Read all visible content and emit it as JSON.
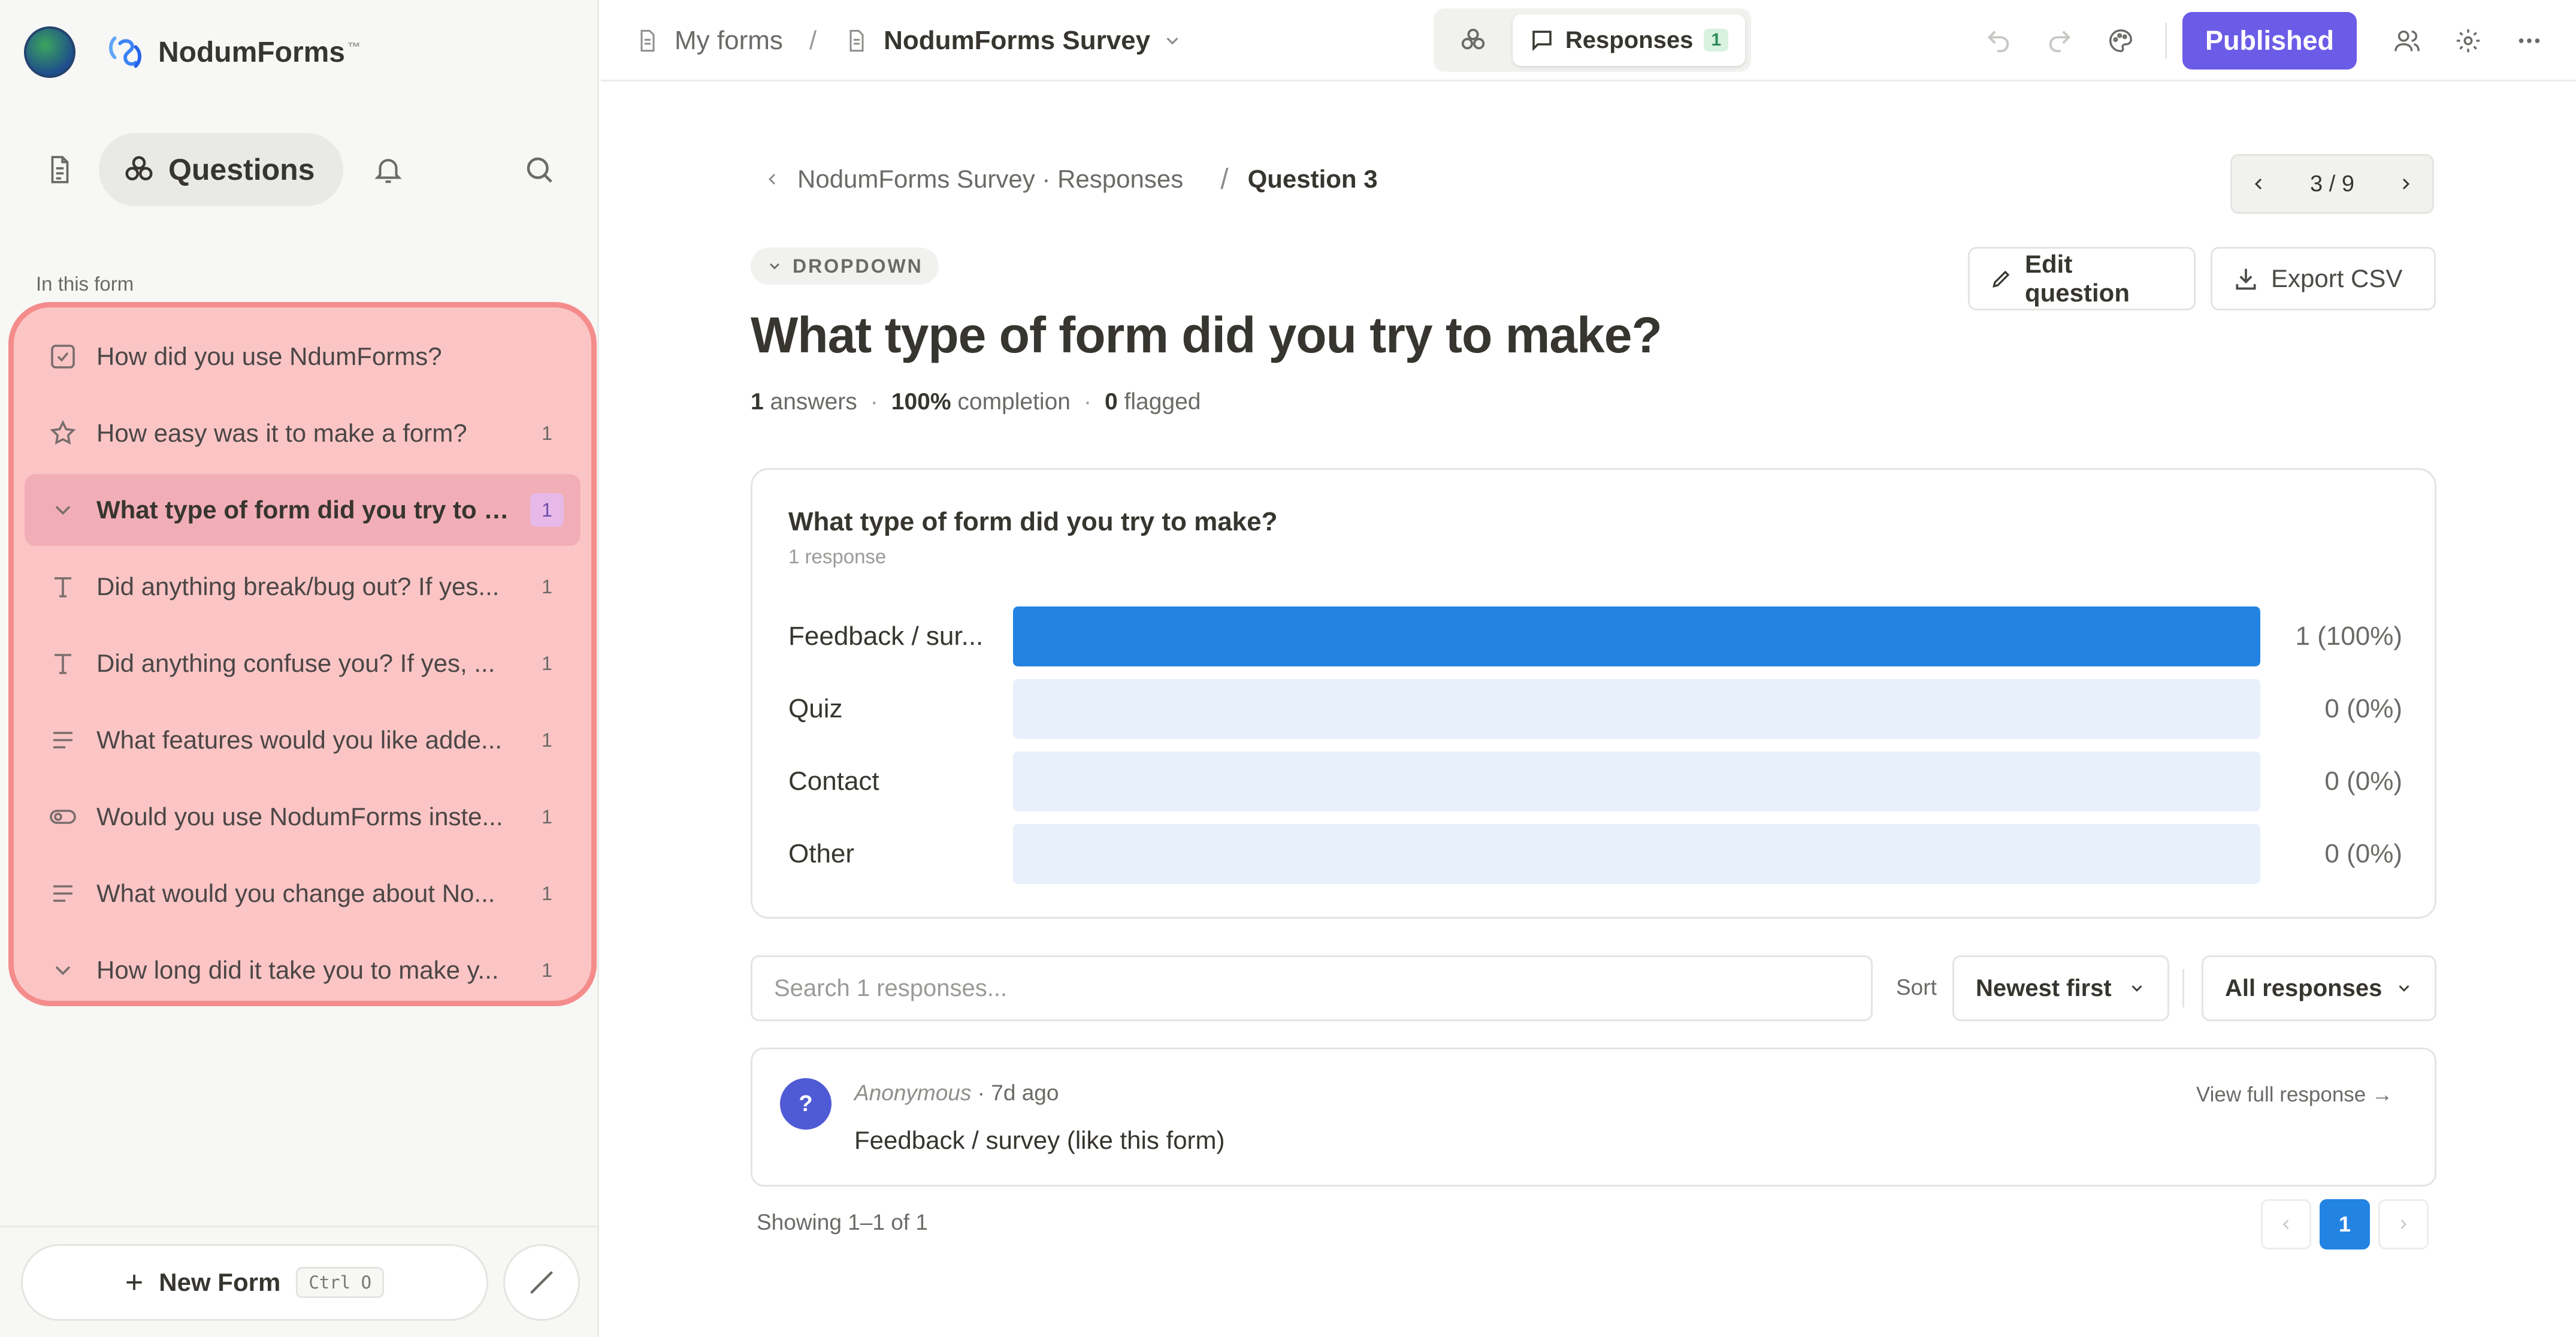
{
  "brand": {
    "name": "NodumForms",
    "tm": "™"
  },
  "colors": {
    "accent": "#2383e2",
    "publish": "#6b5ce7",
    "highlight_fill": "#fbc5c5",
    "highlight_border": "#f58c8c"
  },
  "sidebar": {
    "tabs": [
      {
        "icon": "document-icon"
      },
      {
        "icon": "questions-icon",
        "label": "Questions"
      },
      {
        "icon": "bell-icon"
      },
      {
        "icon": "search-icon"
      }
    ],
    "section_label": "In this form",
    "questions": [
      {
        "icon": "checkbox-icon",
        "label": "How did you use NdumForms?",
        "count": ""
      },
      {
        "icon": "star-icon",
        "label": "How easy was it to make a form?",
        "count": "1"
      },
      {
        "icon": "chevron-down-icon",
        "label": "What type of form did you try to m...",
        "count": "1",
        "active": true
      },
      {
        "icon": "text-icon",
        "label": "Did anything break/bug out? If yes...",
        "count": "1"
      },
      {
        "icon": "text-icon",
        "label": "Did anything confuse you? If yes, ...",
        "count": "1"
      },
      {
        "icon": "paragraph-icon",
        "label": "What features would you like adde...",
        "count": "1"
      },
      {
        "icon": "toggle-icon",
        "label": "Would you use NodumForms inste...",
        "count": "1"
      },
      {
        "icon": "paragraph-icon",
        "label": "What would you change about No...",
        "count": "1"
      },
      {
        "icon": "chevron-down-icon",
        "label": "How long did it take you to make y...",
        "count": "1"
      }
    ],
    "new_form": {
      "label": "New Form",
      "shortcut": "Ctrl O"
    }
  },
  "topbar": {
    "breadcrumb": {
      "root": "My forms",
      "sep": "/",
      "current": "NodumForms Survey"
    },
    "view_toggle": {
      "responses_label": "Responses",
      "responses_count": "1"
    },
    "published_label": "Published"
  },
  "main": {
    "breadcrumb": {
      "parent": "NodumForms Survey · Responses",
      "sep": "/",
      "current": "Question 3"
    },
    "pager": {
      "position": "3 / 9"
    },
    "type_label": "DROPDOWN",
    "edit_label": "Edit question",
    "export_label": "Export CSV",
    "question_title": "What type of form did you try to make?",
    "stats": {
      "answers_value": "1",
      "answers_label": "answers",
      "completion_value": "100%",
      "completion_label": "completion",
      "flagged_value": "0",
      "flagged_label": "flagged"
    },
    "chart": {
      "title": "What type of form did you try to make?",
      "subtitle": "1 response",
      "rows": [
        {
          "label": "Feedback / sur...",
          "fraction": 1,
          "value_text": "1 (100%)"
        },
        {
          "label": "Quiz",
          "fraction": 0,
          "value_text": "0 (0%)"
        },
        {
          "label": "Contact",
          "fraction": 0,
          "value_text": "0 (0%)"
        },
        {
          "label": "Other",
          "fraction": 0,
          "value_text": "0 (0%)"
        }
      ]
    },
    "search": {
      "placeholder": "Search 1 responses..."
    },
    "sort": {
      "label": "Sort",
      "value": "Newest first"
    },
    "filter": {
      "value": "All responses"
    },
    "response": {
      "avatar": "?",
      "author": "Anonymous",
      "time": "7d ago",
      "answer": "Feedback / survey (like this form)",
      "view_full": "View full response →"
    },
    "footer": {
      "showing": "Showing 1–1 of 1",
      "page": "1"
    }
  }
}
